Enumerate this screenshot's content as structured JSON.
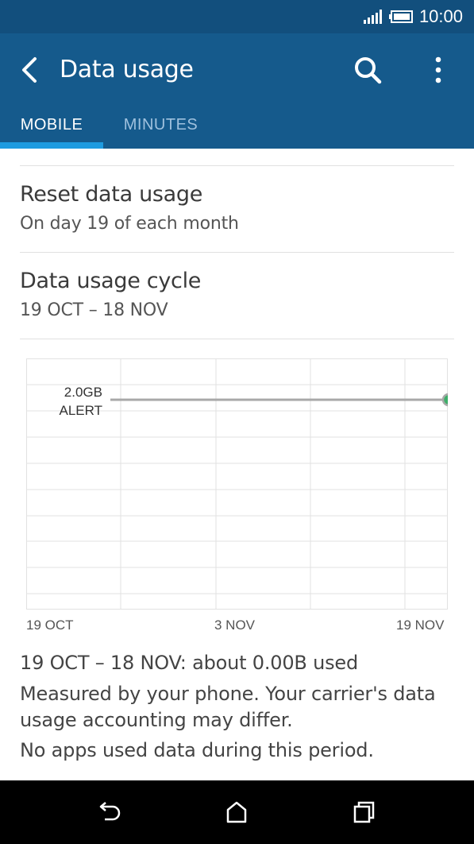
{
  "status_bar": {
    "time": "10:00"
  },
  "app_bar": {
    "title": "Data usage"
  },
  "tabs": [
    {
      "label": "MOBILE",
      "selected": true
    },
    {
      "label": "MINUTES",
      "selected": false
    }
  ],
  "preferences": [
    {
      "title": "Reset data usage",
      "summary": "On day 19 of each month"
    },
    {
      "title": "Data usage cycle",
      "summary": "19 OCT – 18 NOV"
    }
  ],
  "chart_data": {
    "type": "line",
    "x_ticks": [
      "19 OCT",
      "3 NOV",
      "19 NOV"
    ],
    "alert": {
      "value": "2.0GB",
      "label": "ALERT"
    },
    "series": [],
    "colors": {
      "alert_line": "#a8a8a8",
      "alert_handle": "#3fae6a",
      "grid": "#e2e2e2"
    }
  },
  "summary": {
    "usage": "19 OCT – 18 NOV: about 0.00B used",
    "note": "Measured by your phone. Your carrier's data usage accounting may differ.",
    "no_apps": "No apps used data during this period."
  },
  "colors": {
    "app_bar": "#155a8c",
    "status_bar": "#124f7d",
    "tab_indicator": "#1e9be0"
  }
}
